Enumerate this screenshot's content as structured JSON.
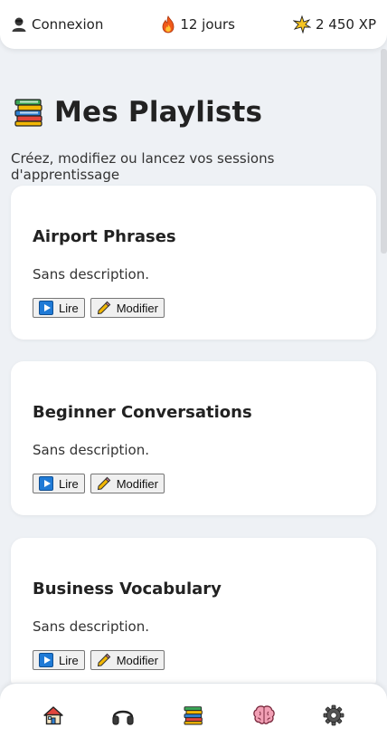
{
  "header": {
    "login_label": "Connexion",
    "streak_label": "12 jours",
    "xp_label": "2 450 XP"
  },
  "page": {
    "title": "Mes Playlists",
    "subtitle": "Créez, modifiez ou lancez vos sessions d'apprentissage"
  },
  "playlists": [
    {
      "title": "Airport Phrases",
      "description": "Sans description.",
      "play_label": "Lire",
      "edit_label": "Modifier"
    },
    {
      "title": "Beginner Conversations",
      "description": "Sans description.",
      "play_label": "Lire",
      "edit_label": "Modifier"
    },
    {
      "title": "Business Vocabulary",
      "description": "Sans description.",
      "play_label": "Lire",
      "edit_label": "Modifier"
    }
  ],
  "nav": {
    "items": [
      {
        "icon": "house-icon"
      },
      {
        "icon": "headphones-icon"
      },
      {
        "icon": "books-icon"
      },
      {
        "icon": "brain-icon"
      },
      {
        "icon": "gear-icon"
      }
    ]
  },
  "colors": {
    "background": "#eef1f5",
    "card": "#ffffff",
    "play_icon": "#1f7ad6",
    "streak": "#f05a1a"
  }
}
